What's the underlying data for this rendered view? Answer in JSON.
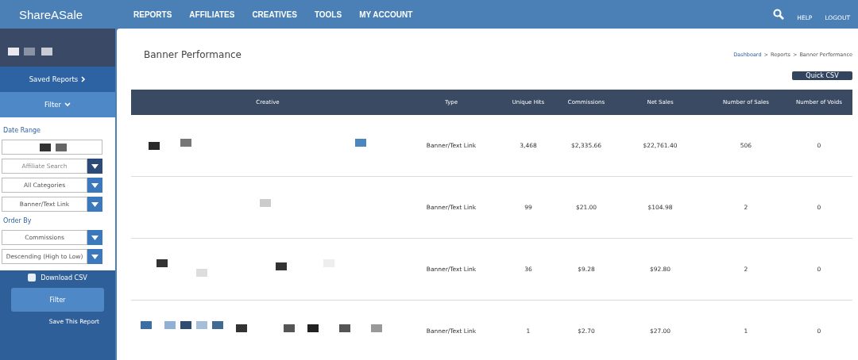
{
  "header": {
    "logo": "ShareASale",
    "nav": [
      {
        "label": "REPORTS"
      },
      {
        "label": "AFFILIATES"
      },
      {
        "label": "CREATIVES"
      },
      {
        "label": "TOOLS"
      },
      {
        "label": "MY ACCOUNT"
      }
    ],
    "links": [
      {
        "label": "HELP"
      },
      {
        "label": "LOGOUT"
      }
    ]
  },
  "sidebar": {
    "saved_reports": "Saved Reports",
    "filter_toggle": "Filter",
    "date_range_label": "Date Range",
    "affiliate_search": {
      "placeholder": "Affiliate Search"
    },
    "selects": [
      {
        "value": "All Categories"
      },
      {
        "value": "Banner/Text Link"
      }
    ],
    "order_by_label": "Order By",
    "order_selects": [
      {
        "value": "Commissions"
      },
      {
        "value": "Descending (High to Low)"
      }
    ],
    "download_csv": {
      "label": "Download CSV",
      "checked": false
    },
    "filter_button": "Filter",
    "save_link": "Save This Report"
  },
  "page": {
    "title": "Banner Performance",
    "breadcrumb": [
      {
        "label": "Dashboard",
        "link": true
      },
      {
        "label": "Reports",
        "link": false
      },
      {
        "label": "Banner Performance",
        "link": false
      }
    ],
    "breadcrumb_separator": ">",
    "quick_csv": "Quick CSV"
  },
  "table": {
    "columns": [
      "Creative",
      "Type",
      "Unique Hits",
      "Commissions",
      "Net Sales",
      "Number of Sales",
      "Number of Voids"
    ],
    "rows": [
      {
        "type": "Banner/Text Link",
        "unique_hits": "3,468",
        "commissions": "$2,335.66",
        "net_sales": "$22,761.40",
        "sales": "506",
        "voids": "0"
      },
      {
        "type": "Banner/Text Link",
        "unique_hits": "99",
        "commissions": "$21.00",
        "net_sales": "$104.98",
        "sales": "2",
        "voids": "0"
      },
      {
        "type": "Banner/Text Link",
        "unique_hits": "36",
        "commissions": "$9.28",
        "net_sales": "$92.80",
        "sales": "2",
        "voids": "0"
      },
      {
        "type": "Banner/Text Link",
        "unique_hits": "1",
        "commissions": "$2.70",
        "net_sales": "$27.00",
        "sales": "1",
        "voids": "0"
      }
    ]
  }
}
